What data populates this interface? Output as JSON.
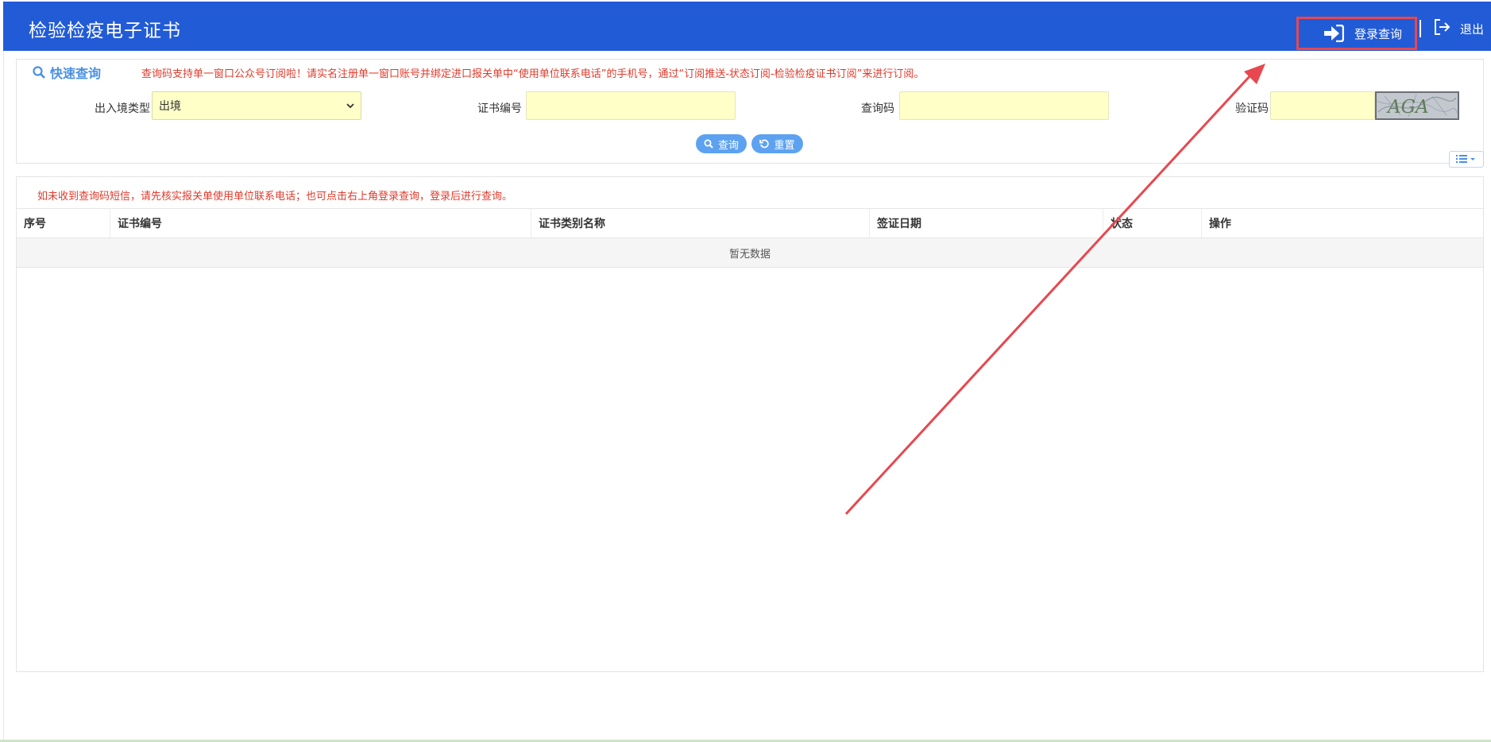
{
  "header": {
    "title": "检验检疫电子证书",
    "login_label": "登录查询",
    "logout_label": "退出"
  },
  "quick_query": {
    "title": "快速查询",
    "notice": "查询码支持单一窗口公众号订阅啦！请实名注册单一窗口账号并绑定进口报关单中“使用单位联系电话”的手机号，通过“订阅推送-状态订阅-检验检疫证书订阅”来进行订阅。",
    "fields": {
      "entry_type": {
        "label": "出入境类型",
        "value": "出境"
      },
      "cert_no": {
        "label": "证书编号",
        "value": ""
      },
      "query_code": {
        "label": "查询码",
        "value": ""
      },
      "captcha": {
        "label": "验证码",
        "value": "",
        "image_text": "AGA"
      }
    },
    "search_label": "查询",
    "reset_label": "重置"
  },
  "results": {
    "notice": "如未收到查询码短信，请先核实报关单使用单位联系电话；也可点击右上角登录查询，登录后进行查询。",
    "columns": [
      "序号",
      "证书编号",
      "证书类别名称",
      "签证日期",
      "状态",
      "操作"
    ],
    "empty_text": "暂无数据"
  },
  "colors": {
    "header_bg": "#225bd6",
    "accent": "#4a90e2",
    "notice_red": "#e03a2b",
    "input_bg": "#ffffc8",
    "annotation_red": "#e8474f"
  }
}
